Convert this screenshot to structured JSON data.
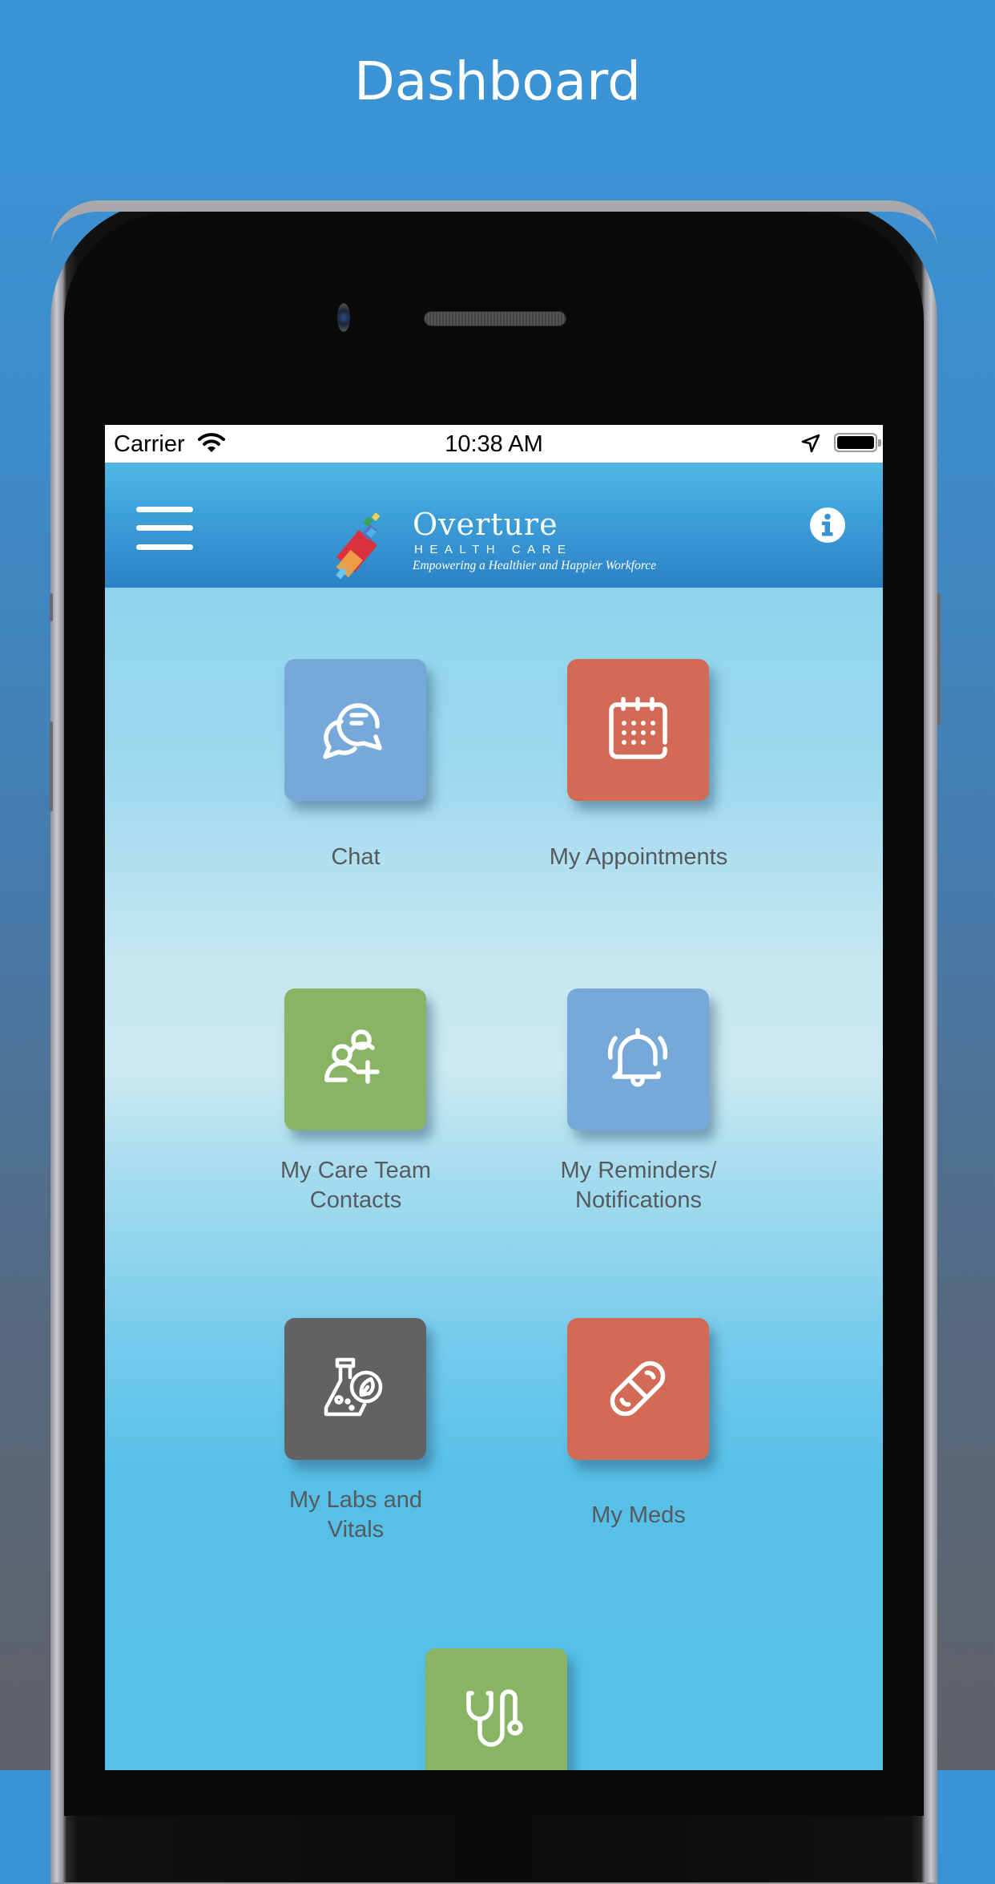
{
  "page": {
    "title": "Dashboard"
  },
  "status_bar": {
    "carrier": "Carrier",
    "time": "10:38 AM",
    "icons": [
      "wifi-icon",
      "location-arrow-icon",
      "battery-icon"
    ]
  },
  "nav_bar": {
    "menu_icon": "hamburger-menu-icon",
    "info_icon": "info-circle-icon",
    "logo": {
      "name": "Overture",
      "subtitle": "HEALTH CARE",
      "tagline": "Empowering a Healthier and Happier Workforce"
    }
  },
  "tiles": [
    {
      "label": "Chat",
      "icon": "chat-bubbles-icon",
      "color": "#76a8d9"
    },
    {
      "label": "My Appointments",
      "icon": "calendar-icon",
      "color": "#d26a55"
    },
    {
      "label": "My Care Team Contacts",
      "icon": "add-user-group-icon",
      "color": "#88b464"
    },
    {
      "label": "My Reminders/ Notifications",
      "icon": "ringing-bell-icon",
      "color": "#76a8d9"
    },
    {
      "label": "My Labs and Vitals",
      "icon": "lab-flask-icon",
      "color": "#626262"
    },
    {
      "label": "My Meds",
      "icon": "pill-capsule-icon",
      "color": "#d26a55"
    },
    {
      "label": "",
      "icon": "stethoscope-icon",
      "color": "#88b464"
    }
  ],
  "tile_label_lines": {
    "care_team": [
      "My Care Team",
      "Contacts"
    ],
    "reminders": [
      "My Reminders/",
      "Notifications"
    ],
    "labs": [
      "My Labs and",
      "Vitals"
    ]
  },
  "colors": {
    "header_gradient_top": "#51b8e4",
    "header_gradient_bottom": "#2b82c4",
    "label_text": "#575a5d",
    "tile_blue": "#76a8d9",
    "tile_red": "#d26a55",
    "tile_green": "#88b464",
    "tile_gray": "#626262"
  }
}
